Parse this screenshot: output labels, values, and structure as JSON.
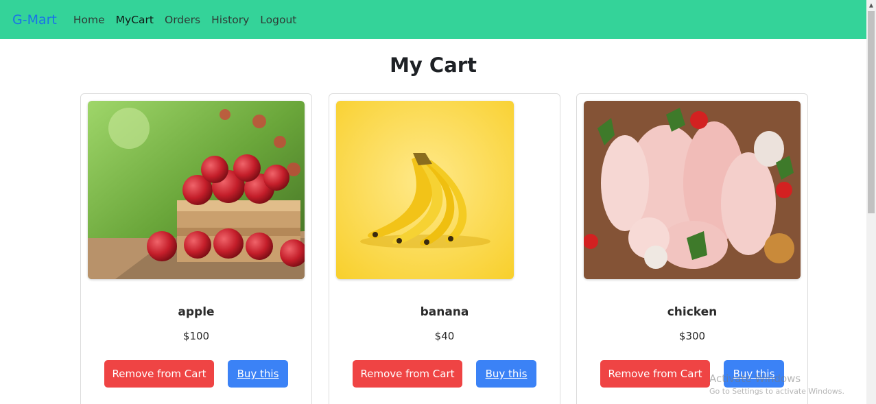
{
  "nav": {
    "brand": "G-Mart",
    "links": [
      "Home",
      "MyCart",
      "Orders",
      "History",
      "Logout"
    ],
    "active": "MyCart"
  },
  "page": {
    "title": "My Cart"
  },
  "cart": {
    "items": [
      {
        "name": "apple",
        "price": "$100",
        "remove_label": "Remove from Cart",
        "buy_label": "Buy this"
      },
      {
        "name": "banana",
        "price": "$40",
        "remove_label": "Remove from Cart",
        "buy_label": "Buy this"
      },
      {
        "name": "chicken",
        "price": "$300",
        "remove_label": "Remove from Cart",
        "buy_label": "Buy this"
      }
    ]
  },
  "watermark": {
    "line1": "Activate Windows",
    "line2": "Go to Settings to activate Windows."
  },
  "colors": {
    "navbar": "#34d399",
    "brand": "#1a73e8",
    "remove_button": "#ef4444",
    "buy_button": "#3b82f6"
  }
}
